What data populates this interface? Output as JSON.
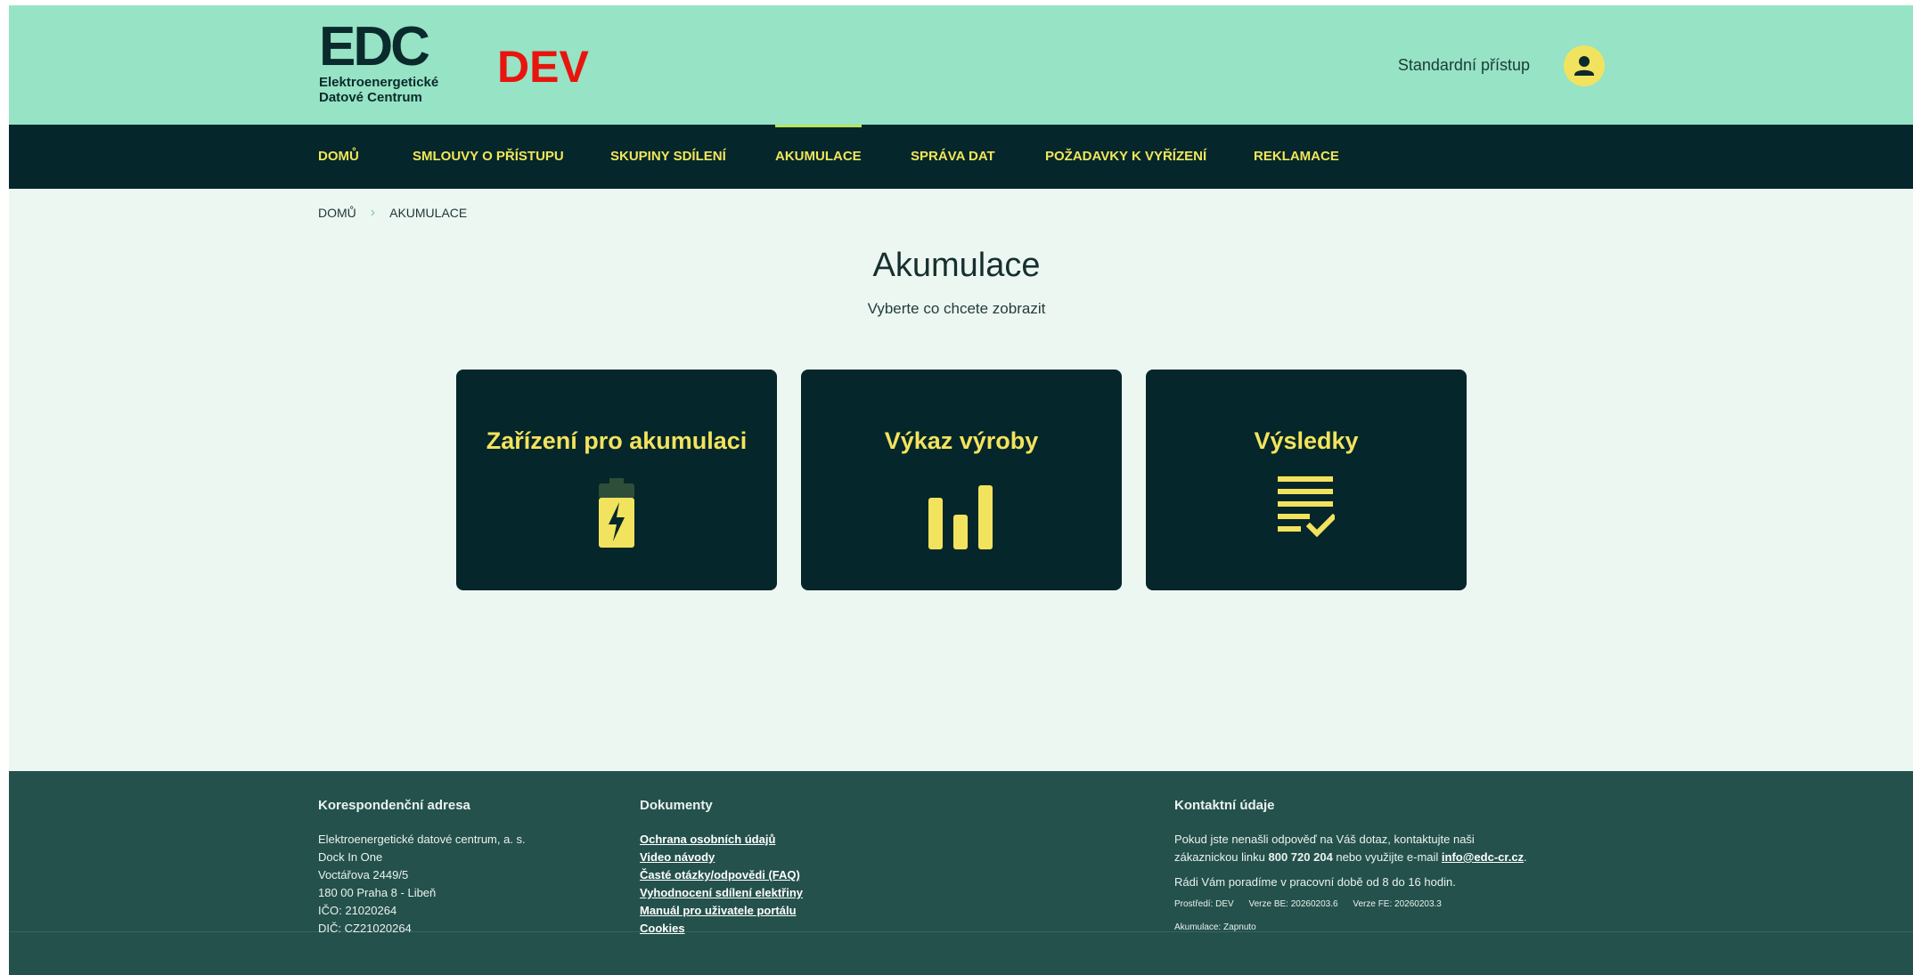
{
  "header": {
    "logo_mark": "EDC",
    "logo_text": "Elektroenergetické\nDatové Centrum",
    "env_badge": "DEV",
    "user_access": "Standardní přístup",
    "avatar_icon": "user-icon"
  },
  "nav": {
    "items": [
      {
        "label": "DOMŮ"
      },
      {
        "label": "SMLOUVY O PŘÍSTUPU"
      },
      {
        "label": "SKUPINY SDÍLENÍ"
      },
      {
        "label": "AKUMULACE",
        "active": true
      },
      {
        "label": "SPRÁVA DAT"
      },
      {
        "label": "POŽADAVKY K VYŘÍZENÍ"
      },
      {
        "label": "REKLAMACE"
      }
    ]
  },
  "breadcrumb": {
    "home": "DOMŮ",
    "separator_icon": "chevron-right-icon",
    "current": "AKUMULACE"
  },
  "page": {
    "title": "Akumulace",
    "subtitle": "Vyberte co chcete zobrazit"
  },
  "cards": [
    {
      "title": "Zařízení pro akumulaci",
      "icon": "battery-charging-icon"
    },
    {
      "title": "Výkaz výroby",
      "icon": "bar-chart-icon"
    },
    {
      "title": "Výsledky",
      "icon": "checklist-icon"
    }
  ],
  "footer": {
    "address": {
      "heading": "Korespondenční adresa",
      "lines": [
        "Elektroenergetické datové centrum, a. s.",
        "Dock In One",
        "Voctářova 2449/5",
        "180 00 Praha 8 - Libeň",
        "IČO: 21020264",
        "DIČ: CZ21020264"
      ]
    },
    "documents": {
      "heading": "Dokumenty",
      "links": [
        "Ochrana osobních údajů",
        "Video návody",
        "Časté otázky/odpovědi (FAQ)",
        "Vyhodnocení sdílení elektřiny",
        "Manuál pro uživatele portálu",
        "Cookies"
      ]
    },
    "contact": {
      "heading": "Kontaktní údaje",
      "text_a": "Pokud jste nenašli odpověď na Váš dotaz, kontaktujte naši",
      "text_b": "zákaznickou linku ",
      "phone": "800 720 204",
      "text_c": " nebo využijte e-mail ",
      "email": "info@edc-cr.cz",
      "text_d": ".",
      "hours": "Rádi Vám poradíme v pracovní době od 8 do 16 hodin.",
      "env": "Prostředí: DEV",
      "version_be": "Verze BE: 20260203.6",
      "version_fe": "Verze FE: 20260203.3",
      "accumulation": "Akumulace: Zapnuto"
    }
  },
  "colors": {
    "header_bg": "#96e3c5",
    "nav_bg": "#05262a",
    "accent_yellow": "#f2e35e",
    "env_red": "#e8150e",
    "footer_bg": "#24514c"
  }
}
